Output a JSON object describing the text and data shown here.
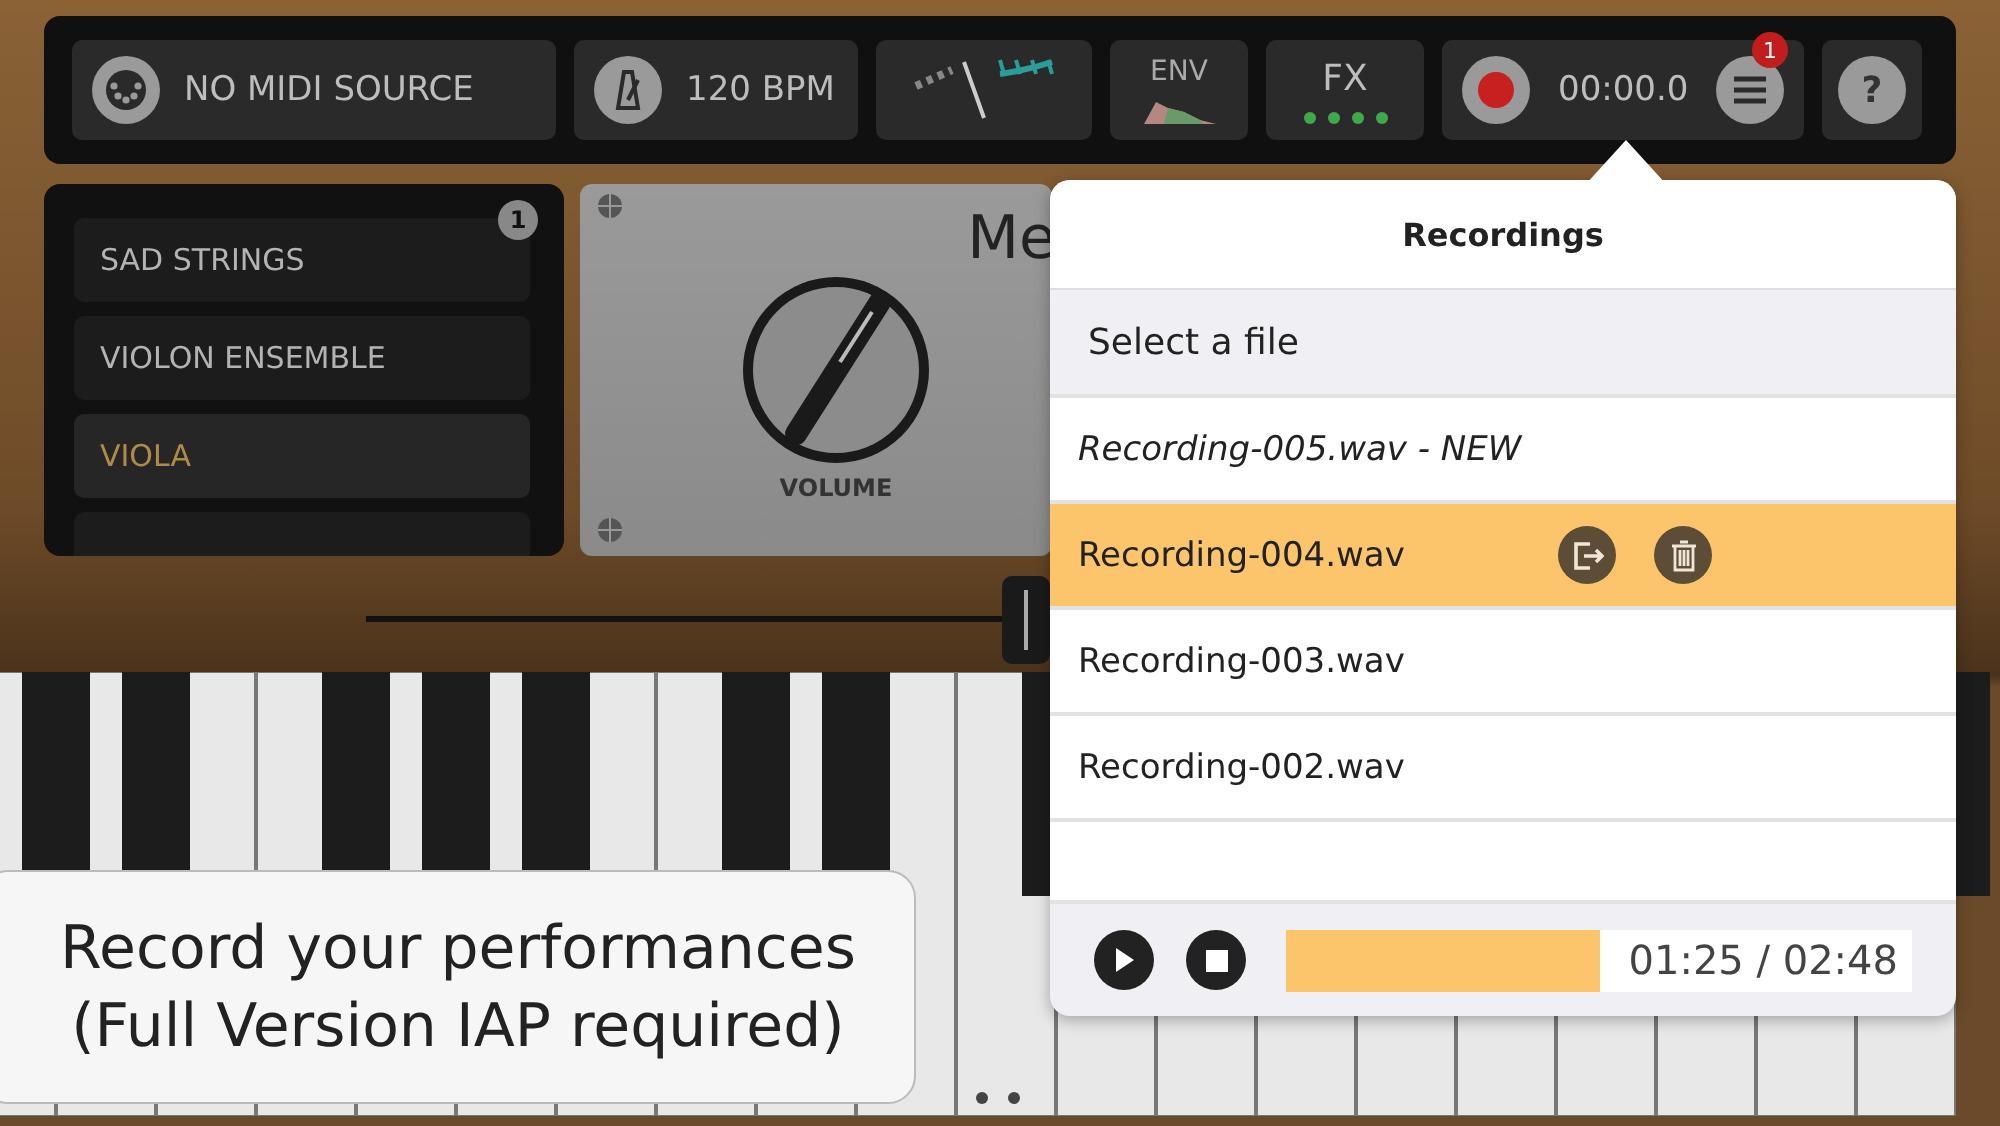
{
  "toolbar": {
    "midi_source": "NO MIDI SOURCE",
    "tempo": "120 BPM",
    "env_label": "ENV",
    "fx_label": "FX",
    "record_time": "00:00.0",
    "menu_badge": "1",
    "help": "?"
  },
  "presets": {
    "badge": "1",
    "items": [
      {
        "name": "SAD STRINGS",
        "selected": false
      },
      {
        "name": "VIOLON ENSEMBLE",
        "selected": false
      },
      {
        "name": "VIOLA",
        "selected": true
      }
    ]
  },
  "panel": {
    "title": "Me",
    "knob_label": "VOLUME"
  },
  "recordings": {
    "title": "Recordings",
    "prompt": "Select a file",
    "files": [
      {
        "name": "Recording-005.wav - NEW",
        "kind": "new",
        "selected": false
      },
      {
        "name": "Recording-004.wav",
        "kind": "file",
        "selected": true
      },
      {
        "name": "Recording-003.wav",
        "kind": "file",
        "selected": false
      },
      {
        "name": "Recording-002.wav",
        "kind": "file",
        "selected": false
      }
    ],
    "player": {
      "level": 0.5,
      "time": "01:25 / 02:48"
    }
  },
  "caption": [
    "Record your performances",
    "(Full Version IAP required)"
  ]
}
